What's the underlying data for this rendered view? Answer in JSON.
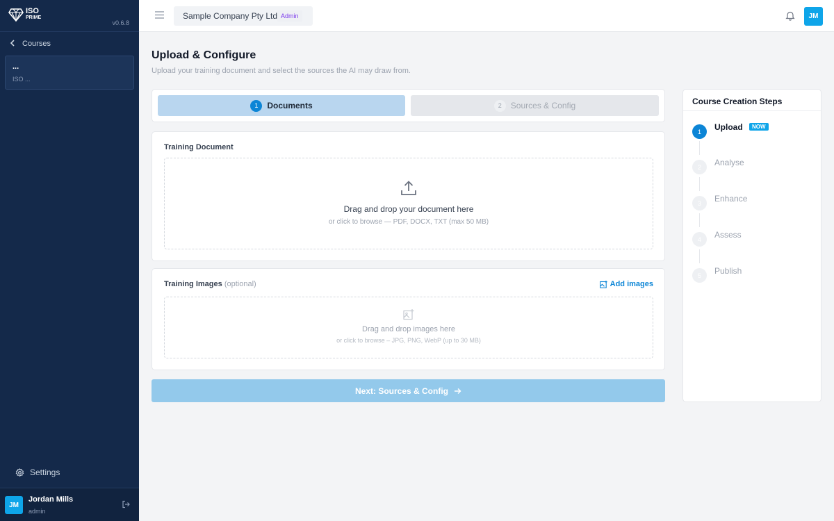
{
  "sidebar": {
    "logo": {
      "line1": "ISO",
      "line2": "PRIME"
    },
    "version": "v0.6.8",
    "back_label": "Courses",
    "course": {
      "title": "...",
      "subtitle": "ISO ..."
    },
    "settings_label": "Settings",
    "user": {
      "initials": "JM",
      "name": "Jordan Mills",
      "role": "admin"
    }
  },
  "topbar": {
    "company": "Sample Company Pty Ltd",
    "role_badge": "Admin",
    "avatar_initials": "JM"
  },
  "page": {
    "title": "Upload & Configure",
    "subtitle": "Upload your training document and select the sources the AI may draw from."
  },
  "wizard_tabs": [
    {
      "num": "1",
      "label": "Documents",
      "active": true
    },
    {
      "num": "2",
      "label": "Sources & Config",
      "active": false
    }
  ],
  "training_document": {
    "label": "Training Document",
    "drop_main": "Drag and drop your document here",
    "drop_sub": "or click to browse — PDF, DOCX, TXT (max 50 MB)"
  },
  "training_images": {
    "label": "Training Images",
    "optional": "(optional)",
    "add_label": "Add images",
    "drop_main": "Drag and drop images here",
    "drop_sub": "or click to browse – JPG, PNG, WebP (up to 30 MB)"
  },
  "next_button": "Next: Sources & Config",
  "course_steps": {
    "title": "Course Creation Steps",
    "now_badge": "NOW",
    "steps": [
      {
        "num": "1",
        "label": "Upload",
        "active": true
      },
      {
        "num": "2",
        "label": "Analyse",
        "active": false
      },
      {
        "num": "3",
        "label": "Enhance",
        "active": false
      },
      {
        "num": "4",
        "label": "Assess",
        "active": false
      },
      {
        "num": "5",
        "label": "Publish",
        "active": false
      }
    ]
  },
  "colors": {
    "sidebar_bg": "#14294a",
    "accent": "#0c85d6",
    "avatar": "#0ea5e9",
    "admin_badge_text": "#7c3aed"
  }
}
